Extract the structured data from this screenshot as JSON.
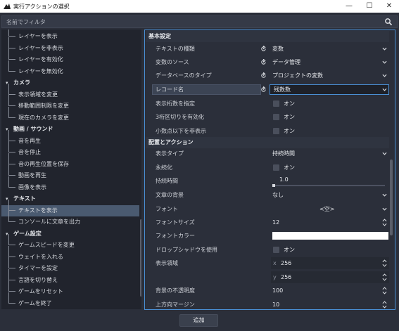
{
  "window": {
    "title": "実行アクションの選択",
    "minimize_glyph": "—",
    "maximize_glyph": "☐",
    "close_glyph": "✕"
  },
  "filter": {
    "placeholder": "名前でフィルタ",
    "value": ""
  },
  "tree": [
    {
      "kind": "item",
      "label": "レイヤーを表示"
    },
    {
      "kind": "item",
      "label": "レイヤーを非表示"
    },
    {
      "kind": "item",
      "label": "レイヤーを有効化"
    },
    {
      "kind": "item",
      "label": "レイヤーを無効化"
    },
    {
      "kind": "category",
      "label": "カメラ"
    },
    {
      "kind": "item",
      "label": "表示領域を変更"
    },
    {
      "kind": "item",
      "label": "移動範囲制限を変更"
    },
    {
      "kind": "item",
      "label": "現在のカメラを変更"
    },
    {
      "kind": "category",
      "label": "動画 / サウンド"
    },
    {
      "kind": "item",
      "label": "音を再生"
    },
    {
      "kind": "item",
      "label": "音を停止"
    },
    {
      "kind": "item",
      "label": "音の再生位置を保存"
    },
    {
      "kind": "item",
      "label": "動画を再生"
    },
    {
      "kind": "item",
      "label": "画像を表示"
    },
    {
      "kind": "category",
      "label": "テキスト"
    },
    {
      "kind": "item",
      "label": "テキストを表示",
      "selected": true
    },
    {
      "kind": "item",
      "label": "コンソールに文章を出力"
    },
    {
      "kind": "category",
      "label": "ゲーム設定"
    },
    {
      "kind": "item",
      "label": "ゲームスピードを変更"
    },
    {
      "kind": "item",
      "label": "ウェイトを入れる"
    },
    {
      "kind": "item",
      "label": "タイマーを設定"
    },
    {
      "kind": "item",
      "label": "言語を切り替え"
    },
    {
      "kind": "item",
      "label": "ゲームをリセット"
    },
    {
      "kind": "item",
      "label": "ゲームを終了"
    }
  ],
  "props": {
    "section_basic": "基本設定",
    "text_type": {
      "label": "テキストの種類",
      "value": "変数"
    },
    "var_source": {
      "label": "変数のソース",
      "value": "データ管理"
    },
    "db_type": {
      "label": "データベースのタイプ",
      "value": "プロジェクトの変数"
    },
    "record_name": {
      "label": "レコード名",
      "value": "残数数"
    },
    "show_digits": {
      "label": "表示桁数を指定",
      "check": "オン"
    },
    "digit_sep": {
      "label": "3桁区切りを有効化",
      "check": "オン"
    },
    "hide_decimals": {
      "label": "小数点以下を非表示",
      "check": "オン"
    },
    "section_layout": "配置とアクション",
    "display_type": {
      "label": "表示タイプ",
      "value": "持続時間"
    },
    "persist": {
      "label": "永続化",
      "check": "オン"
    },
    "duration": {
      "label": "持続時間",
      "value": "1.0"
    },
    "text_bg": {
      "label": "文章の背景",
      "value": "なし"
    },
    "font": {
      "label": "フォント",
      "value": "<空>"
    },
    "font_size": {
      "label": "フォントサイズ",
      "value": "12"
    },
    "font_color": {
      "label": "フォントカラー",
      "color": "#ffffff"
    },
    "drop_shadow": {
      "label": "ドロップシャドウを使用",
      "check": "オン"
    },
    "display_area": {
      "label": "表示領域",
      "x_tag": "x",
      "x": "256",
      "y_tag": "y",
      "y": "256"
    },
    "bg_opacity": {
      "label": "背景の不透明度",
      "value": "100"
    },
    "top_margin": {
      "label": "上方向マージン",
      "value": "10"
    }
  },
  "footer": {
    "add_label": "追加"
  }
}
